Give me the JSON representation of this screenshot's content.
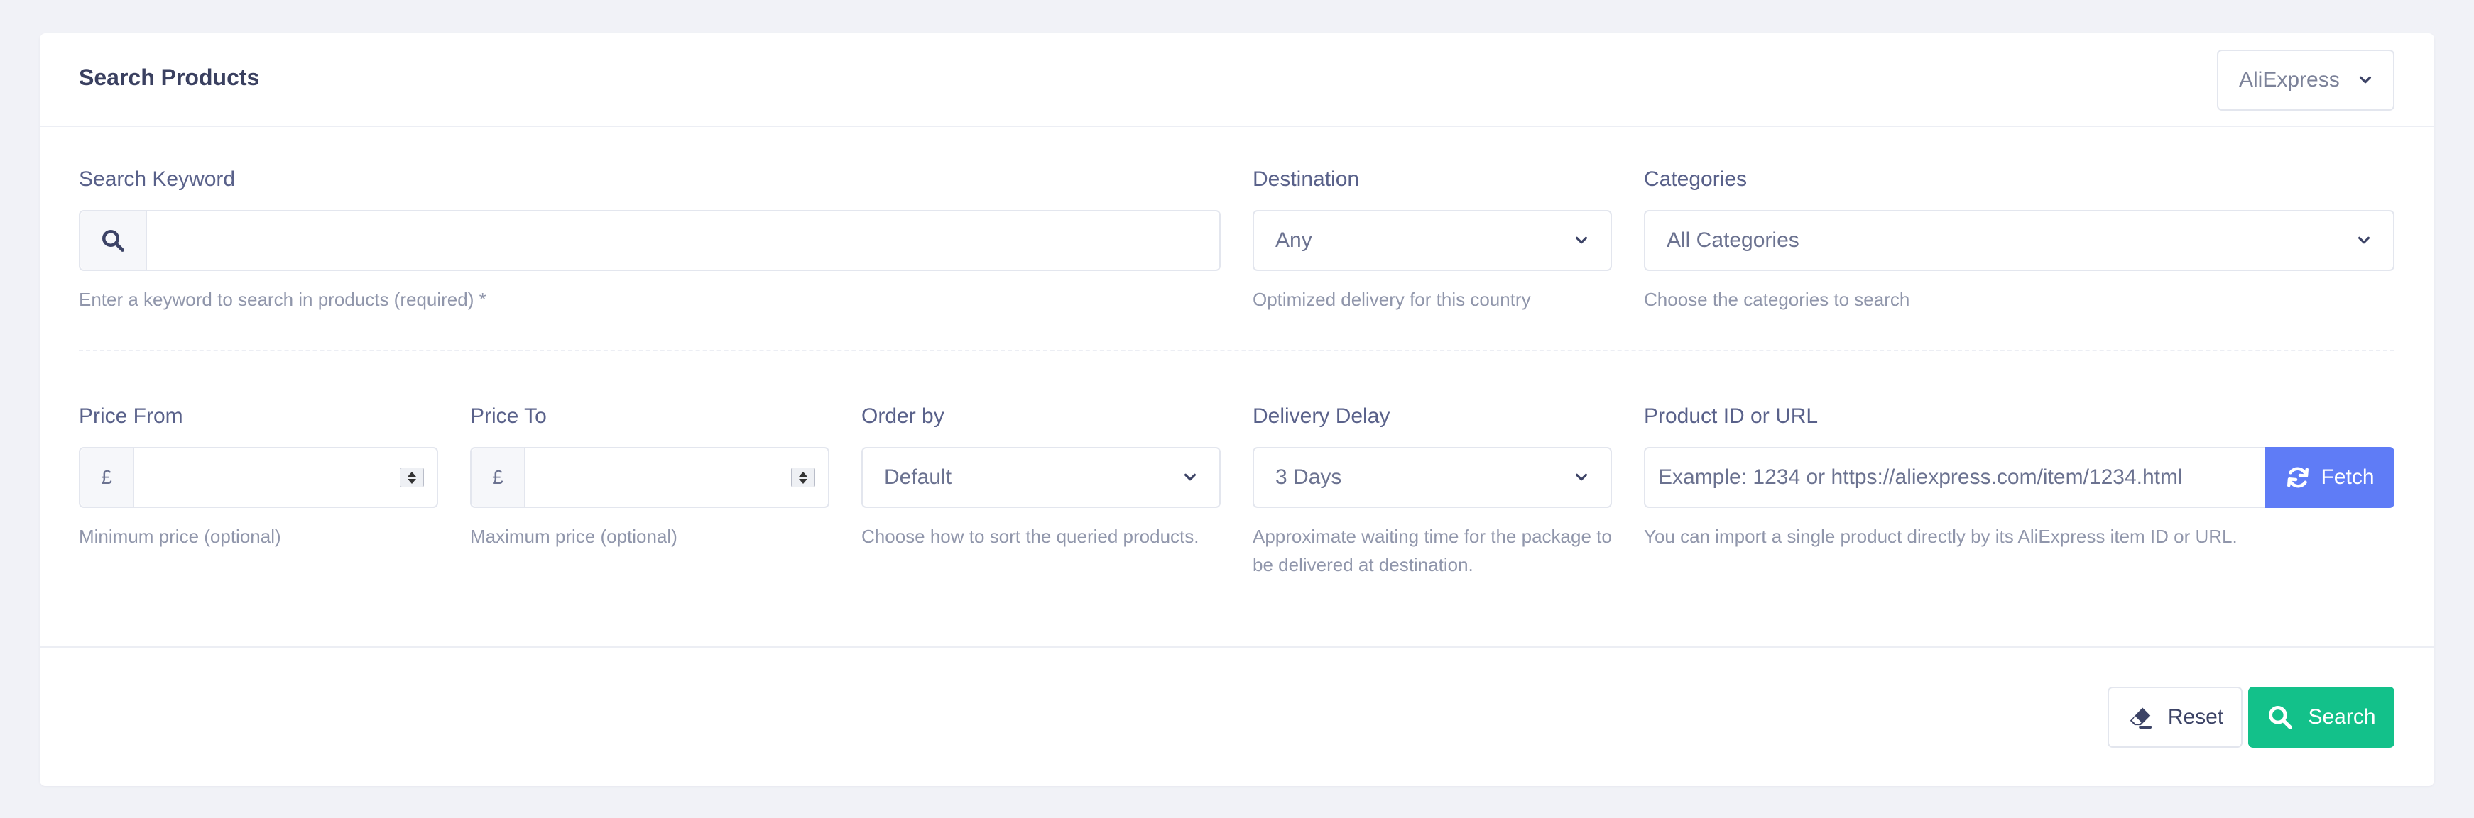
{
  "header": {
    "title": "Search Products",
    "store_select": "AliExpress"
  },
  "search_keyword": {
    "label": "Search Keyword",
    "value": "",
    "hint": "Enter a keyword to search in products (required) *"
  },
  "destination": {
    "label": "Destination",
    "value": "Any",
    "hint": "Optimized delivery for this country"
  },
  "categories": {
    "label": "Categories",
    "value": "All Categories",
    "hint": "Choose the categories to search"
  },
  "price_from": {
    "label": "Price From",
    "currency": "£",
    "value": "",
    "hint": "Minimum price (optional)"
  },
  "price_to": {
    "label": "Price To",
    "currency": "£",
    "value": "",
    "hint": "Maximum price (optional)"
  },
  "order_by": {
    "label": "Order by",
    "value": "Default",
    "hint": "Choose how to sort the queried products."
  },
  "delivery_delay": {
    "label": "Delivery Delay",
    "value": "3 Days",
    "hint_line1": "Approximate waiting time for the package to",
    "hint_line2": "be delivered at destination."
  },
  "product_id": {
    "label": "Product ID or URL",
    "placeholder": "Example: 1234 or https://aliexpress.com/item/1234.html",
    "fetch_label": "Fetch",
    "hint": "You can import a single product directly by its AliExpress item ID or URL."
  },
  "footer": {
    "reset_label": "Reset",
    "search_label": "Search"
  },
  "colors": {
    "fetch": "#5f7cf6",
    "search": "#13c18a",
    "background": "#f1f2f7"
  }
}
